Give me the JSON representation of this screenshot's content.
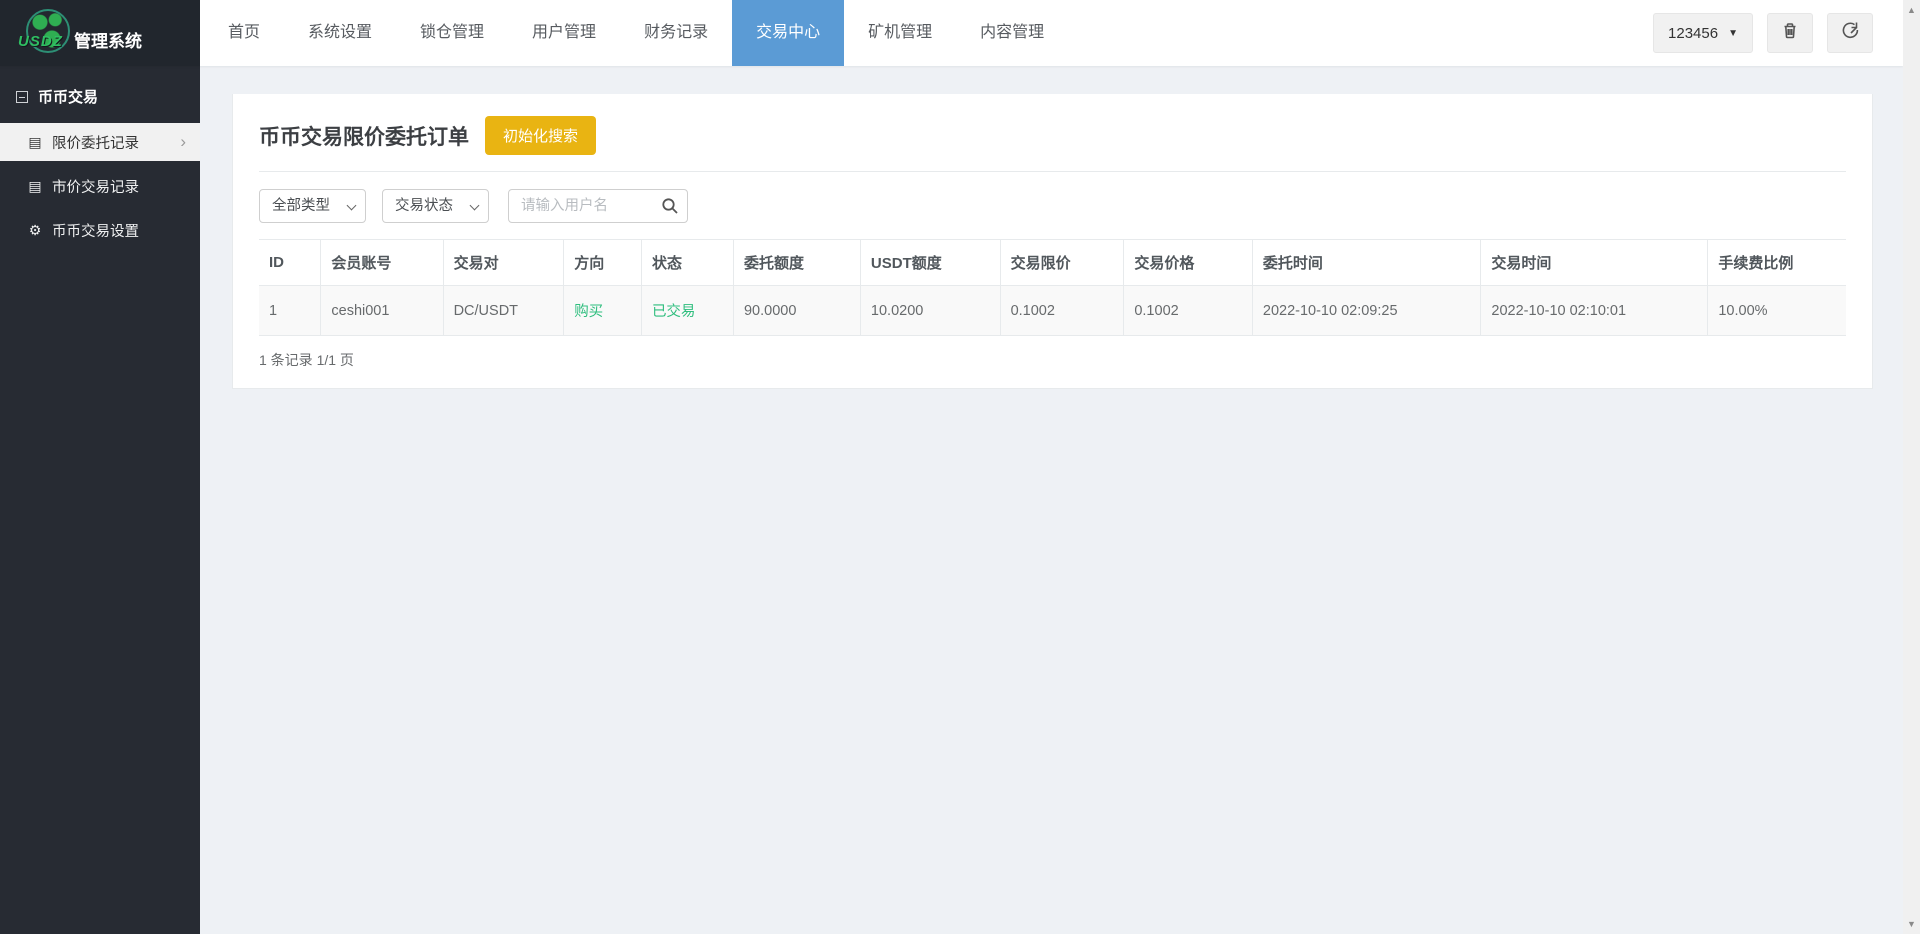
{
  "navbar": {
    "brand": {
      "logo_text": "USDZ",
      "title": "管理系统"
    },
    "items": [
      {
        "label": "首页",
        "active": false
      },
      {
        "label": "系统设置",
        "active": false
      },
      {
        "label": "锁仓管理",
        "active": false
      },
      {
        "label": "用户管理",
        "active": false
      },
      {
        "label": "财务记录",
        "active": false
      },
      {
        "label": "交易中心",
        "active": true
      },
      {
        "label": "矿机管理",
        "active": false
      },
      {
        "label": "内容管理",
        "active": false
      }
    ],
    "user_menu_label": "123456"
  },
  "sidebar": {
    "group_label": "币币交易",
    "items": [
      {
        "label": "限价委托记录",
        "icon": "list-icon",
        "active": true
      },
      {
        "label": "市价交易记录",
        "icon": "list-icon",
        "active": false
      },
      {
        "label": "币币交易设置",
        "icon": "gear-icon",
        "active": false
      }
    ]
  },
  "main": {
    "title": "币币交易限价委托订单",
    "reset_button_label": "初始化搜索",
    "filters": {
      "type_select_value": "全部类型",
      "status_select_value": "交易状态",
      "username_placeholder": "请输入用户名"
    },
    "table": {
      "columns": [
        "ID",
        "会员账号",
        "交易对",
        "方向",
        "状态",
        "委托额度",
        "USDT额度",
        "交易限价",
        "交易价格",
        "委托时间",
        "交易时间",
        "手续费比例"
      ],
      "rows": [
        [
          "1",
          "ceshi001",
          "DC/USDT",
          "购买",
          "已交易",
          "90.0000",
          "10.0200",
          "0.1002",
          "0.1002",
          "2022-10-10 02:09:25",
          "2022-10-10 02:10:01",
          "10.00%"
        ]
      ],
      "green_cell_indexes": [
        3,
        4
      ]
    },
    "footer_text": "1 条记录 1/1 页"
  },
  "colors": {
    "nav_active_blue": "#5b9bd5",
    "button_yellow": "#e9b412",
    "status_green": "#2fbe7e",
    "sidebar_bg": "#272b33",
    "page_bg": "#eef1f5"
  },
  "icons": [
    "globe-logo-icon",
    "caret-down-icon",
    "trash-icon",
    "logout-icon",
    "collapse-minus-icon",
    "list-icon",
    "gear-icon",
    "chevron-right-icon",
    "chevron-down-icon",
    "search-icon",
    "scroll-up-icon",
    "scroll-down-icon"
  ]
}
